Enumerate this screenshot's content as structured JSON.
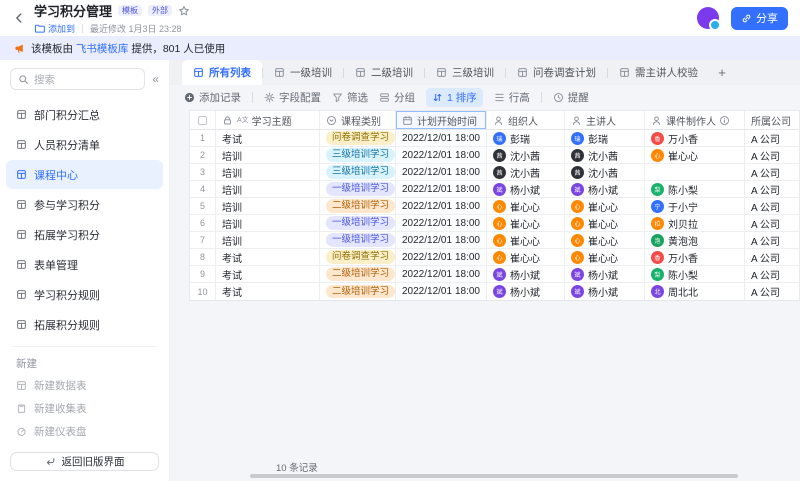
{
  "header": {
    "title": "学习积分管理",
    "badges": [
      "模板",
      "外部"
    ],
    "add_to": "添加到",
    "modified": "最近修改  1月3日 23:28",
    "share_label": "分享"
  },
  "banner": {
    "prefix": "该模板由",
    "link": "飞书模板库",
    "suffix": "提供，801 人已使用"
  },
  "sidebar": {
    "search_placeholder": "搜索",
    "items": [
      {
        "name": "dept-points-summary",
        "label": "部门积分汇总",
        "active": false
      },
      {
        "name": "member-points-list",
        "label": "人员积分清单",
        "active": false
      },
      {
        "name": "course-center",
        "label": "课程中心",
        "active": true
      },
      {
        "name": "participate-learning-points",
        "label": "参与学习积分",
        "active": false
      },
      {
        "name": "extended-learning-points",
        "label": "拓展学习积分",
        "active": false
      },
      {
        "name": "form-management",
        "label": "表单管理",
        "active": false
      },
      {
        "name": "learning-points-rules",
        "label": "学习积分规则",
        "active": false
      },
      {
        "name": "extended-points-rules",
        "label": "拓展积分规则",
        "active": false
      }
    ],
    "new_section": {
      "title": "新建",
      "items": [
        {
          "name": "new-datasheet",
          "label": "新建数据表",
          "icon": "grid"
        },
        {
          "name": "new-form",
          "label": "新建收集表",
          "icon": "clipboard"
        },
        {
          "name": "new-dashboard",
          "label": "新建仪表盘",
          "icon": "gauge"
        }
      ]
    },
    "back_button": "返回旧版界面"
  },
  "tabbar": {
    "tabs": [
      {
        "name": "all-list",
        "label": "所有列表",
        "active": true
      },
      {
        "name": "level1-training",
        "label": "一级培训",
        "active": false
      },
      {
        "name": "level2-training",
        "label": "二级培训",
        "active": false
      },
      {
        "name": "level3-training",
        "label": "三级培训",
        "active": false
      },
      {
        "name": "survey-plan",
        "label": "问卷调查计划",
        "active": false
      },
      {
        "name": "speaker-verification",
        "label": "需主讲人校验",
        "active": false
      }
    ],
    "add_label": "+"
  },
  "toolbar": {
    "add_record": "添加记录",
    "field_config": "字段配置",
    "filter": "筛选",
    "group": "分组",
    "sort_label": "1 排序",
    "row_height": "行高",
    "remind": "提醒"
  },
  "table": {
    "columns": [
      {
        "type": "checkbox",
        "name": "col-select"
      },
      {
        "name": "col-topic",
        "label": "学习主题",
        "icons": [
          "lock",
          "textA"
        ]
      },
      {
        "name": "col-category",
        "label": "课程类别",
        "icons": [
          "select"
        ]
      },
      {
        "name": "col-start-time",
        "label": "计划开始时间",
        "icons": [
          "calendar"
        ],
        "sorted": true
      },
      {
        "name": "col-organizer",
        "label": "组织人",
        "icons": [
          "person"
        ]
      },
      {
        "name": "col-speaker",
        "label": "主讲人",
        "icons": [
          "person"
        ]
      },
      {
        "name": "col-courseware-maker",
        "label": "课件制作人",
        "icons": [
          "person"
        ],
        "info": true
      },
      {
        "name": "col-company",
        "label": "所属公司",
        "icons": []
      }
    ],
    "category_styles": {
      "问卷调查学习": {
        "bg": "#FAEFC8",
        "fg": "#8F7000"
      },
      "三级培训学习": {
        "bg": "#D9F3FD",
        "fg": "#1273A3"
      },
      "一级培训学习": {
        "bg": "#E3E6FE",
        "fg": "#4C56E0"
      },
      "二级培训学习": {
        "bg": "#FEE7CD",
        "fg": "#B0610A"
      }
    },
    "rows": [
      {
        "num": "1",
        "topic": "考试",
        "category": "问卷调查学习",
        "date": "2022/12/01",
        "time": "18:00",
        "organizer": {
          "name": "彭瑞",
          "color": "#3370FF"
        },
        "speaker": {
          "name": "彭瑞",
          "color": "#3370FF"
        },
        "maker": {
          "name": "万小香",
          "color": "#F54A45"
        },
        "company": "A 公司"
      },
      {
        "num": "2",
        "topic": "培训",
        "category": "三级培训学习",
        "date": "2022/12/01",
        "time": "18:00",
        "organizer": {
          "name": "沈小茜",
          "color": "#2F3238"
        },
        "speaker": {
          "name": "沈小茜",
          "color": "#2F3238"
        },
        "maker": {
          "name": "崔心心",
          "color": "#FF8800"
        },
        "company": "A 公司"
      },
      {
        "num": "3",
        "topic": "培训",
        "category": "三级培训学习",
        "date": "2022/12/01",
        "time": "18:00",
        "organizer": {
          "name": "沈小茜",
          "color": "#2F3238"
        },
        "speaker": {
          "name": "沈小茜",
          "color": "#2F3238"
        },
        "maker": null,
        "company": "A 公司"
      },
      {
        "num": "4",
        "topic": "培训",
        "category": "一级培训学习",
        "date": "2022/12/01",
        "time": "18:00",
        "organizer": {
          "name": "杨小斌",
          "color": "#7B45E6"
        },
        "speaker": {
          "name": "杨小斌",
          "color": "#7B45E6"
        },
        "maker": {
          "name": "陈小梨",
          "color": "#17B26A"
        },
        "company": "A 公司"
      },
      {
        "num": "5",
        "topic": "培训",
        "category": "二级培训学习",
        "date": "2022/12/01",
        "time": "18:00",
        "organizer": {
          "name": "崔心心",
          "color": "#FF8800"
        },
        "speaker": {
          "name": "崔心心",
          "color": "#FF8800"
        },
        "maker": {
          "name": "于小宁",
          "color": "#3370FF"
        },
        "company": "A 公司"
      },
      {
        "num": "6",
        "topic": "培训",
        "category": "一级培训学习",
        "date": "2022/12/01",
        "time": "18:00",
        "organizer": {
          "name": "崔心心",
          "color": "#FF8800"
        },
        "speaker": {
          "name": "崔心心",
          "color": "#FF8800"
        },
        "maker": {
          "name": "刘贝拉",
          "color": "#FF8800"
        },
        "company": "A 公司"
      },
      {
        "num": "7",
        "topic": "培训",
        "category": "一级培训学习",
        "date": "2022/12/01",
        "time": "18:00",
        "organizer": {
          "name": "崔心心",
          "color": "#FF8800"
        },
        "speaker": {
          "name": "崔心心",
          "color": "#FF8800"
        },
        "maker": {
          "name": "黄泡泡",
          "color": "#17A35D"
        },
        "company": "A 公司"
      },
      {
        "num": "8",
        "topic": "考试",
        "category": "问卷调查学习",
        "date": "2022/12/01",
        "time": "18:00",
        "organizer": {
          "name": "崔心心",
          "color": "#FF8800"
        },
        "speaker": {
          "name": "崔心心",
          "color": "#FF8800"
        },
        "maker": {
          "name": "万小香",
          "color": "#F54A45"
        },
        "company": "A 公司"
      },
      {
        "num": "9",
        "topic": "考试",
        "category": "二级培训学习",
        "date": "2022/12/01",
        "time": "18:00",
        "organizer": {
          "name": "杨小斌",
          "color": "#7B45E6"
        },
        "speaker": {
          "name": "杨小斌",
          "color": "#7B45E6"
        },
        "maker": {
          "name": "陈小梨",
          "color": "#17B26A"
        },
        "company": "A 公司"
      },
      {
        "num": "10",
        "topic": "考试",
        "category": "二级培训学习",
        "date": "2022/12/01",
        "time": "18:00",
        "organizer": {
          "name": "杨小斌",
          "color": "#7B45E6"
        },
        "speaker": {
          "name": "杨小斌",
          "color": "#7B45E6"
        },
        "maker": {
          "name": "周北北",
          "color": "#7B45E6"
        },
        "company": "A 公司"
      }
    ],
    "record_count": "10 条记录"
  }
}
